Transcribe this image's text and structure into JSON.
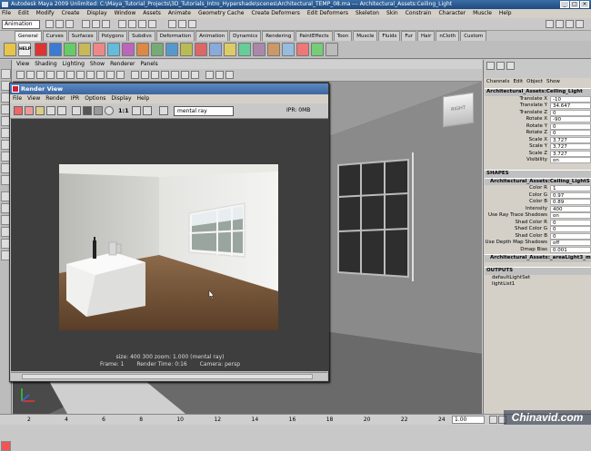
{
  "app": {
    "title": "Autodesk Maya 2009 Unlimited: C:\\Maya_Tutorial_Projects\\3D_Tutorials_Intro_Hypershade\\scenes\\Architectural_TEMP_08.ma  ---  Architectural_Assets:Ceiling_Light",
    "window_buttons": [
      "_",
      "□",
      "×"
    ]
  },
  "menubar": [
    "File",
    "Edit",
    "Modify",
    "Create",
    "Display",
    "Window",
    "Assets",
    "Animate",
    "Geometry Cache",
    "Create Deformers",
    "Edit Deformers",
    "Skeleton",
    "Skin",
    "Constrain",
    "Character",
    "Muscle",
    "Help"
  ],
  "statusline": {
    "mode": "Animation"
  },
  "shelf_tabs": [
    "General",
    "Curves",
    "Surfaces",
    "Polygons",
    "Subdivs",
    "Deformation",
    "Animation",
    "Dynamics",
    "Rendering",
    "PaintEffects",
    "Toon",
    "Muscle",
    "Fluids",
    "Fur",
    "Hair",
    "nCloth",
    "Custom"
  ],
  "shelf_active": "General",
  "shelf_help_label": "HELP",
  "viewport": {
    "menu": [
      "View",
      "Shading",
      "Lighting",
      "Show",
      "Renderer",
      "Panels"
    ],
    "viewcube_label": "RIGHT"
  },
  "render_view": {
    "title": "Render View",
    "menu": [
      "File",
      "View",
      "Render",
      "IPR",
      "Options",
      "Display",
      "Help"
    ],
    "ratio_label": "1:1",
    "renderer": "mental ray",
    "ipr_status": "IPR: 0MB",
    "info_line1": "size:  400  300  zoom: 1.000     (mental ray)",
    "frame": "Frame: 1",
    "render_time": "Render Time: 0:16",
    "camera": "Camera: persp"
  },
  "attribute_panel": {
    "menu": [
      "Channels",
      "Edit",
      "Object",
      "Show"
    ],
    "object_name": "Architectural_Assets:Ceiling_Light",
    "transform": [
      {
        "k": "Translate X",
        "v": "-10"
      },
      {
        "k": "Translate Y",
        "v": "34.647"
      },
      {
        "k": "Translate Z",
        "v": "0"
      },
      {
        "k": "Rotate X",
        "v": "-90"
      },
      {
        "k": "Rotate Y",
        "v": "0"
      },
      {
        "k": "Rotate Z",
        "v": "0"
      },
      {
        "k": "Scale X",
        "v": "3.727"
      },
      {
        "k": "Scale Y",
        "v": "3.727"
      },
      {
        "k": "Scale Z",
        "v": "3.727"
      },
      {
        "k": "Visibility",
        "v": "on"
      }
    ],
    "shapes_header": "SHAPES",
    "shape_name": "Architectural_Assets:Ceiling_LightS",
    "shape_attrs": [
      {
        "k": "Color R",
        "v": "1"
      },
      {
        "k": "Color G",
        "v": "0.97"
      },
      {
        "k": "Color B",
        "v": "0.89"
      },
      {
        "k": "Intensity",
        "v": "400"
      },
      {
        "k": "Use Ray Trace Shadows",
        "v": "on"
      },
      {
        "k": "Shad Color R",
        "v": "0"
      },
      {
        "k": "Shad Color G",
        "v": "0"
      },
      {
        "k": "Shad Color B",
        "v": "0"
      },
      {
        "k": "Use Depth Map Shadows",
        "v": "off"
      },
      {
        "k": "Dmap Bias",
        "v": "0.001"
      }
    ],
    "shape_name2": "Architectural_Assets:_areaLight3_mr",
    "outputs_header": "OUTPUTS",
    "outputs": [
      "defaultLightSet",
      "lightList1"
    ]
  },
  "timeline": {
    "ticks": [
      "2",
      "4",
      "6",
      "8",
      "10",
      "12",
      "14",
      "16",
      "18",
      "20",
      "22",
      "24"
    ],
    "current": "1.00"
  },
  "watermark": "Chinavid.com",
  "colors": {
    "title_blue": "#2b5a92",
    "viewport_bg": "#4a4a4a",
    "render_bg": "#3e3e3e"
  }
}
